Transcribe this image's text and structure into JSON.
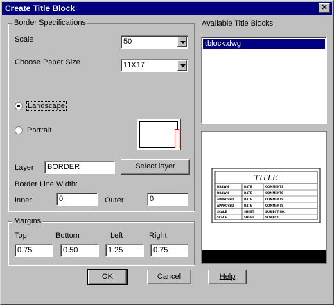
{
  "window": {
    "title": "Create Title Block",
    "close_glyph": "✕"
  },
  "border_group": {
    "label": "Border Specifications",
    "scale_label": "Scale",
    "scale_value": "50",
    "paper_label": "Choose Paper Size",
    "paper_value": "11X17",
    "landscape_label": "Landscape",
    "portrait_label": "Portrait",
    "layer_label": "Layer",
    "layer_value": "BORDER",
    "select_layer_label": "Select layer",
    "line_width_label": "Border Line Width:",
    "inner_label": "Inner",
    "inner_value": "0",
    "outer_label": "Outer",
    "outer_value": "0"
  },
  "margins_group": {
    "label": "Margins",
    "top_label": "Top",
    "top_value": "0.75",
    "bottom_label": "Bottom",
    "bottom_value": "0.50",
    "left_label": "Left",
    "left_value": "1.25",
    "right_label": "Right",
    "right_value": "0.75"
  },
  "available": {
    "label": "Available Title Blocks",
    "items": [
      "tblock.dwg"
    ]
  },
  "titleblock_preview": {
    "title": "TITLE",
    "rows": [
      [
        "DRAWN",
        "DATE",
        "COMMENTS"
      ],
      [
        "DRAWN",
        "DATE",
        "COMMENTS"
      ],
      [
        "APPROVED",
        "DATE",
        "COMMENTS"
      ],
      [
        "APPROVED",
        "DATE",
        "COMMENTS"
      ],
      [
        "SCALE",
        "SHEET",
        "SUBJECT NO."
      ],
      [
        "SCALE",
        "SHEET",
        "SUBJECT"
      ]
    ]
  },
  "buttons": {
    "ok": "OK",
    "cancel": "Cancel",
    "help": "Help"
  }
}
